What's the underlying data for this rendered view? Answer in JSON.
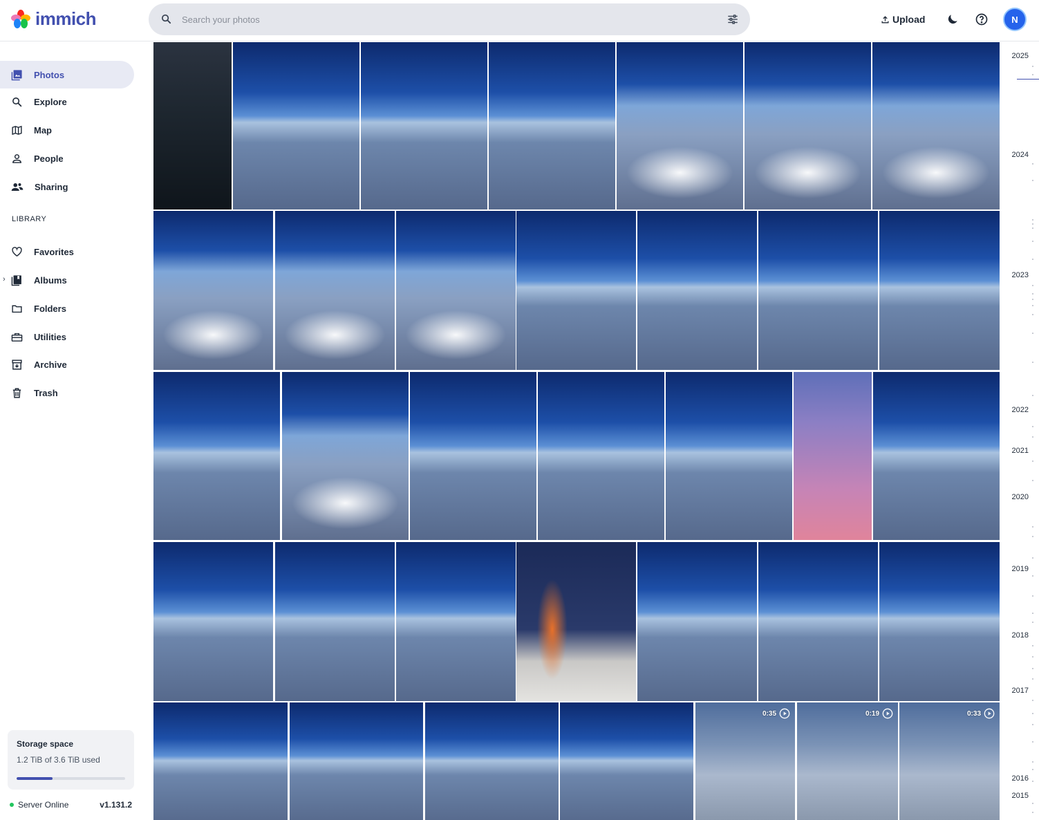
{
  "app": {
    "name": "immich"
  },
  "header": {
    "search_placeholder": "Search your photos",
    "upload_label": "Upload",
    "avatar_initial": "N"
  },
  "sidebar": {
    "items": [
      {
        "label": "Photos",
        "icon": "photos-icon",
        "active": true
      },
      {
        "label": "Explore",
        "icon": "search-icon"
      },
      {
        "label": "Map",
        "icon": "map-icon"
      },
      {
        "label": "People",
        "icon": "person-icon"
      },
      {
        "label": "Sharing",
        "icon": "people-icon"
      }
    ],
    "library_label": "LIBRARY",
    "library_items": [
      {
        "label": "Favorites",
        "icon": "heart-icon"
      },
      {
        "label": "Albums",
        "icon": "album-icon"
      },
      {
        "label": "Folders",
        "icon": "folder-icon"
      },
      {
        "label": "Utilities",
        "icon": "toolbox-icon"
      },
      {
        "label": "Archive",
        "icon": "archive-icon"
      },
      {
        "label": "Trash",
        "icon": "trash-icon"
      }
    ]
  },
  "storage": {
    "title": "Storage space",
    "usage": "1.2 TiB of 3.6 TiB used",
    "used_fraction": 0.33
  },
  "server": {
    "status": "Server Online",
    "version": "v1.131.2"
  },
  "videos": [
    {
      "duration": "0:35"
    },
    {
      "duration": "0:19"
    },
    {
      "duration": "0:33"
    }
  ],
  "timeline": {
    "years": [
      "2025",
      "2024",
      "2023",
      "2022",
      "2021",
      "2020",
      "2019",
      "2018",
      "2017",
      "2016",
      "2015"
    ]
  },
  "colors": {
    "accent": "#4250af",
    "avatar": "#2563eb",
    "online": "#22c55e"
  }
}
